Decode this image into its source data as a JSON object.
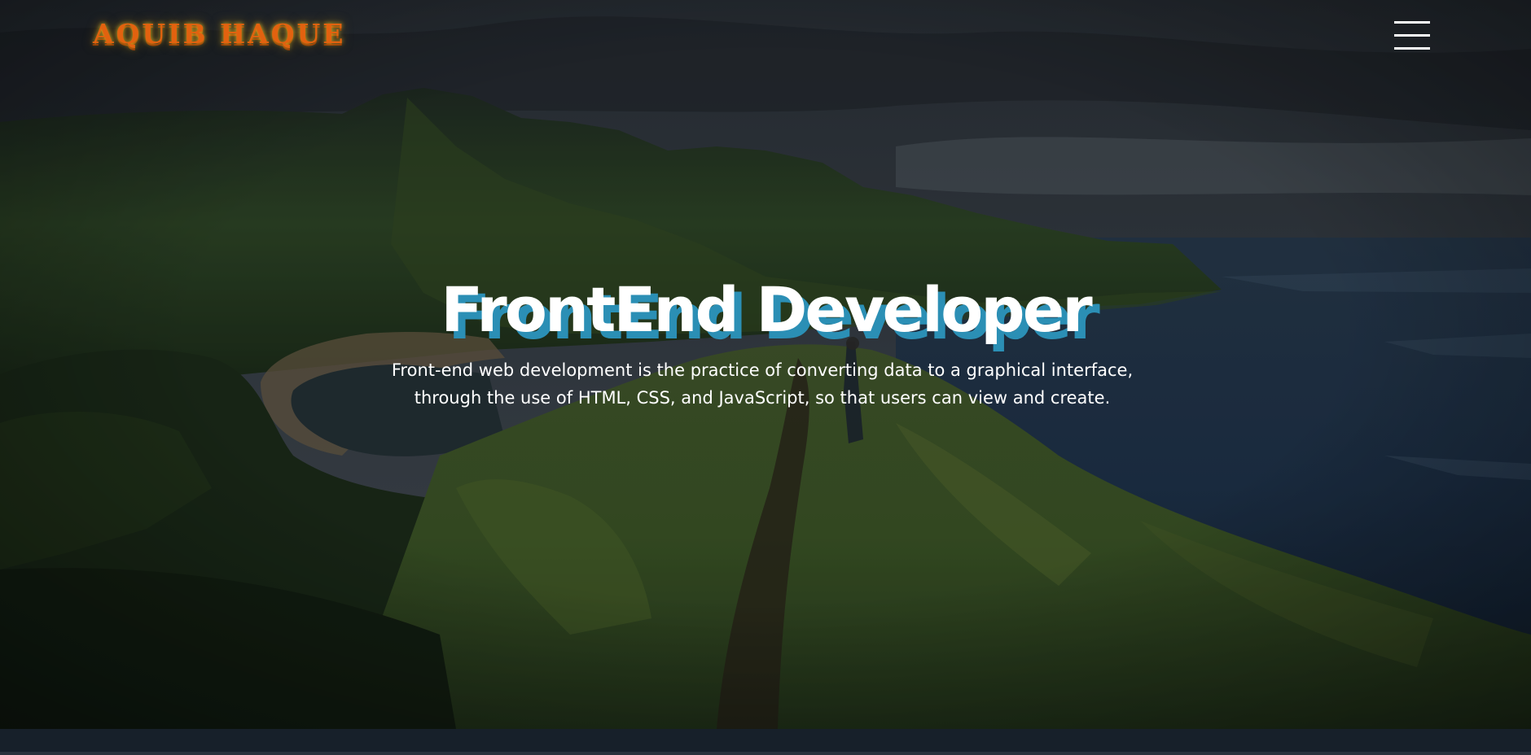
{
  "header": {
    "logo_text": "AQUIB HAQUE",
    "menu_icon": "hamburger-menu-icon"
  },
  "hero": {
    "title": "FrontEnd Developer",
    "description": "Front-end web development is the practice of converting data to a graphical interface, through the use of HTML, CSS, and JavaScript, so that users can view and create.",
    "background": "mountain-coastline-photo"
  },
  "colors": {
    "logo": "#e2620f",
    "logo_glow": "#f0c828",
    "title_shadow": "#2b8fb5",
    "text": "#ffffff",
    "footer": "#17202a"
  }
}
